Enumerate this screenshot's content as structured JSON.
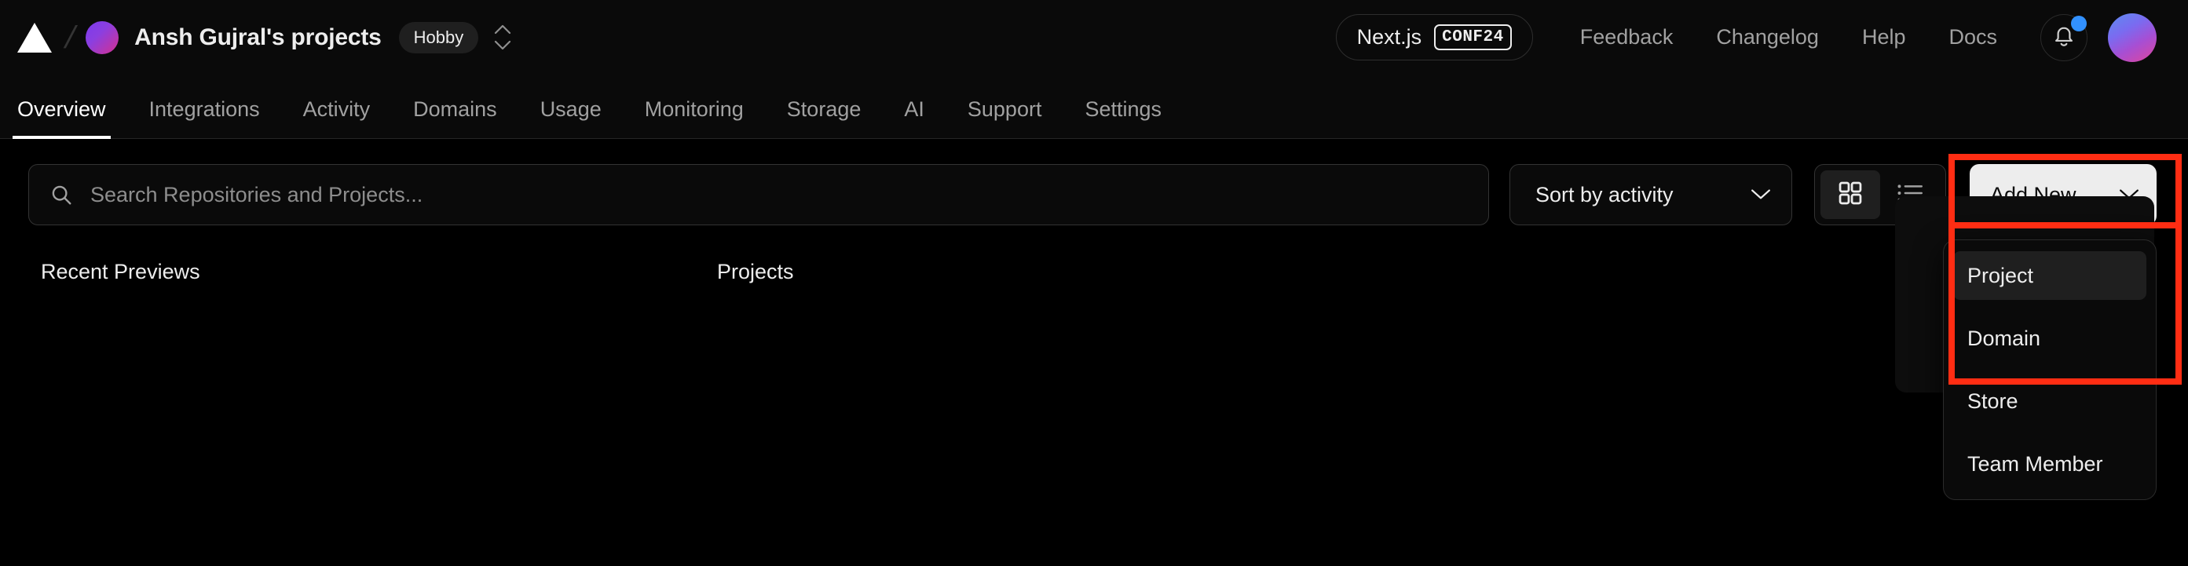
{
  "header": {
    "logo_icon": "vercel-triangle-logo",
    "separator": "/",
    "team_name": "Ansh Gujral's projects",
    "plan_badge": "Hobby",
    "team_switcher_icon": "chevron-up-down-icon",
    "conf_pill": {
      "label": "Next.js",
      "tag": "CONF24"
    },
    "links": [
      {
        "label": "Feedback",
        "name": "feedback-link"
      },
      {
        "label": "Changelog",
        "name": "changelog-link"
      },
      {
        "label": "Help",
        "name": "help-link"
      },
      {
        "label": "Docs",
        "name": "docs-link"
      }
    ],
    "notifications_icon": "bell-icon",
    "has_unread": true,
    "unread_dot_color": "#3291ff",
    "avatar_icon": "user-avatar"
  },
  "tabs": [
    {
      "label": "Overview",
      "active": true
    },
    {
      "label": "Integrations",
      "active": false
    },
    {
      "label": "Activity",
      "active": false
    },
    {
      "label": "Domains",
      "active": false
    },
    {
      "label": "Usage",
      "active": false
    },
    {
      "label": "Monitoring",
      "active": false
    },
    {
      "label": "Storage",
      "active": false
    },
    {
      "label": "AI",
      "active": false
    },
    {
      "label": "Support",
      "active": false
    },
    {
      "label": "Settings",
      "active": false
    }
  ],
  "toolbar": {
    "search": {
      "icon": "search-icon",
      "value": "",
      "placeholder": "Search Repositories and Projects..."
    },
    "sort": {
      "selected": "Sort by activity",
      "chevron_icon": "chevron-down-icon"
    },
    "view": {
      "grid_icon": "grid-view-icon",
      "list_icon": "list-view-icon",
      "active": "grid"
    },
    "add_new": {
      "label": "Add New...",
      "chevron_icon": "chevron-down-icon",
      "expanded": true,
      "menu_items": [
        {
          "label": "Project",
          "highlighted": true
        },
        {
          "label": "Domain",
          "highlighted": false
        },
        {
          "label": "Store",
          "highlighted": false
        },
        {
          "label": "Team Member",
          "highlighted": false
        }
      ]
    }
  },
  "content": {
    "recent_previews_heading": "Recent Previews",
    "projects_heading": "Projects"
  },
  "annotation": {
    "color": "#ff2d13",
    "target": "add-new-button-and-project-menu-item"
  }
}
